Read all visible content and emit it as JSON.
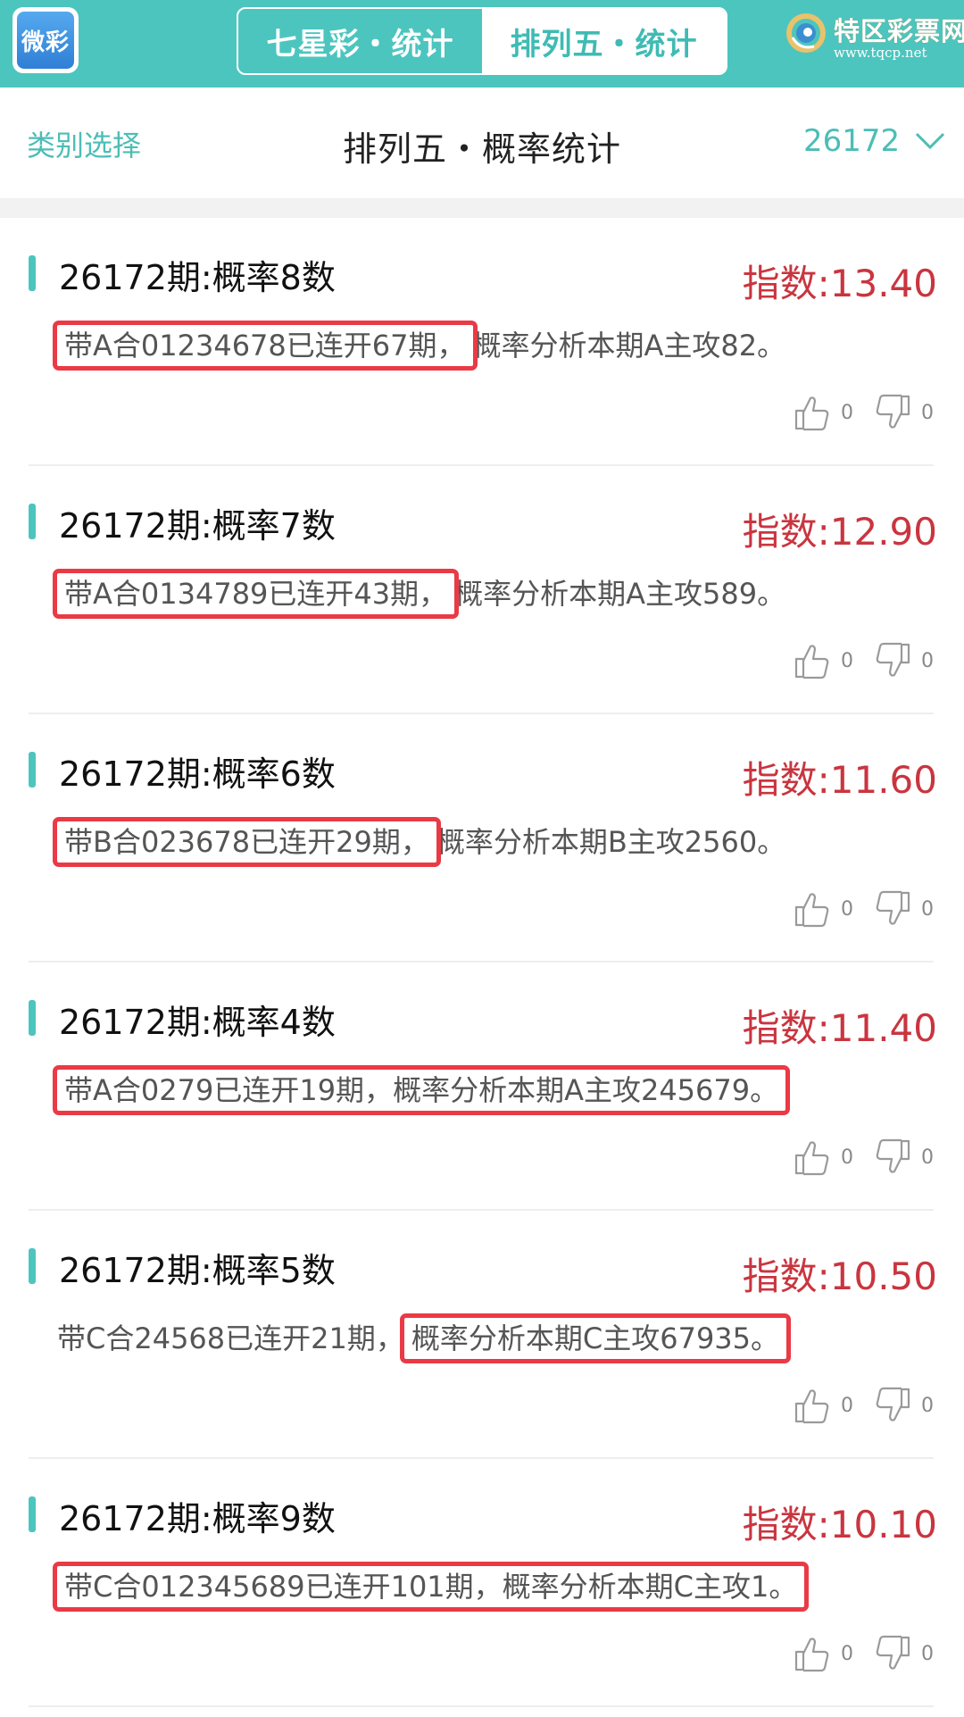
{
  "header": {
    "app_logo_text": "微彩",
    "tabs": [
      {
        "label": "七星彩・统计",
        "active": false
      },
      {
        "label": "排列五・统计",
        "active": true
      }
    ],
    "brand_name": "特区彩票网",
    "brand_url": "www.tqcp.net"
  },
  "filter": {
    "category_label": "类别选择",
    "title": "排列五・概率统计",
    "issue": "26172"
  },
  "colors": {
    "accent": "#4cc5bf",
    "index_red": "#c9353f",
    "highlight_red": "#ea3a45"
  },
  "cards": [
    {
      "title": "26172期:概率8数",
      "index": "指数:13.40",
      "desc_a": "带A合01234678已连开67期，",
      "desc_b": "概率分析本期A主攻82。",
      "likes": "0",
      "dislikes": "0"
    },
    {
      "title": "26172期:概率7数",
      "index": "指数:12.90",
      "desc_a": "带A合0134789已连开43期，",
      "desc_b": "概率分析本期A主攻589。",
      "likes": "0",
      "dislikes": "0"
    },
    {
      "title": "26172期:概率6数",
      "index": "指数:11.60",
      "desc_a": "带B合023678已连开29期，",
      "desc_b": "概率分析本期B主攻2560。",
      "likes": "0",
      "dislikes": "0"
    },
    {
      "title": "26172期:概率4数",
      "index": "指数:11.40",
      "desc_a": "带A合0279已连开19期，",
      "desc_b": "概率分析本期A主攻245679。",
      "likes": "0",
      "dislikes": "0"
    },
    {
      "title": "26172期:概率5数",
      "index": "指数:10.50",
      "desc_a": "带C合24568已连开21期，",
      "desc_b": "概率分析本期C主攻67935。",
      "likes": "0",
      "dislikes": "0"
    },
    {
      "title": "26172期:概率9数",
      "index": "指数:10.10",
      "desc_a": "带C合012345689已连开101期，",
      "desc_b": "概率分析本期C主攻1。",
      "likes": "0",
      "dislikes": "0"
    }
  ]
}
